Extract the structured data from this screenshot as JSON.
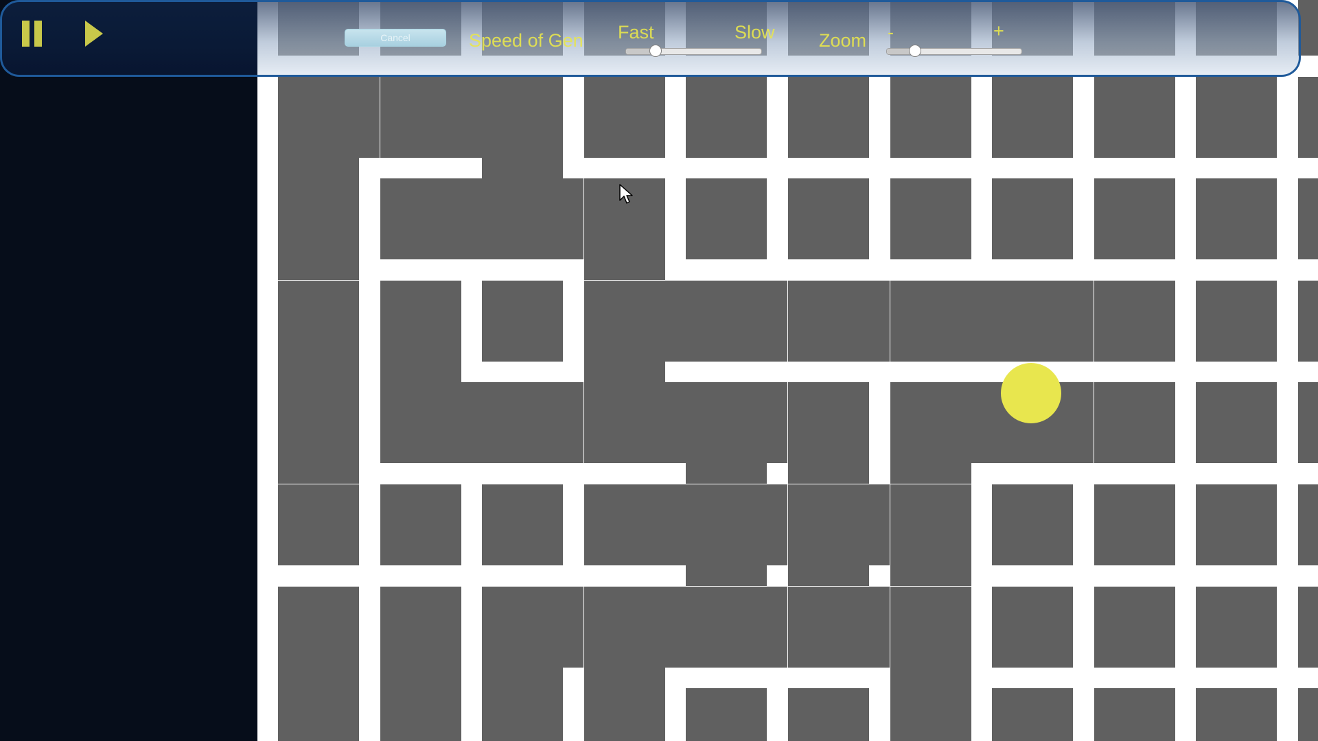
{
  "toolbar": {
    "cancel_label": "Cancel",
    "speed_label": "Speed of  Gen",
    "fast_label": "Fast",
    "slow_label": "Slow",
    "zoom_label": "Zoom",
    "zoom_minus_label": "-",
    "zoom_plus_label": "+",
    "speed_value": 0.22,
    "zoom_value": 0.21
  },
  "colors": {
    "accent": "#e8e64e",
    "wall": "#ffffff",
    "path": "#606060",
    "background": "#060d1a",
    "toolbar_border": "#1f5a9a"
  },
  "icons": {
    "pause": "pause-icon",
    "play": "play-icon",
    "cursor": "mouse-cursor-icon"
  }
}
